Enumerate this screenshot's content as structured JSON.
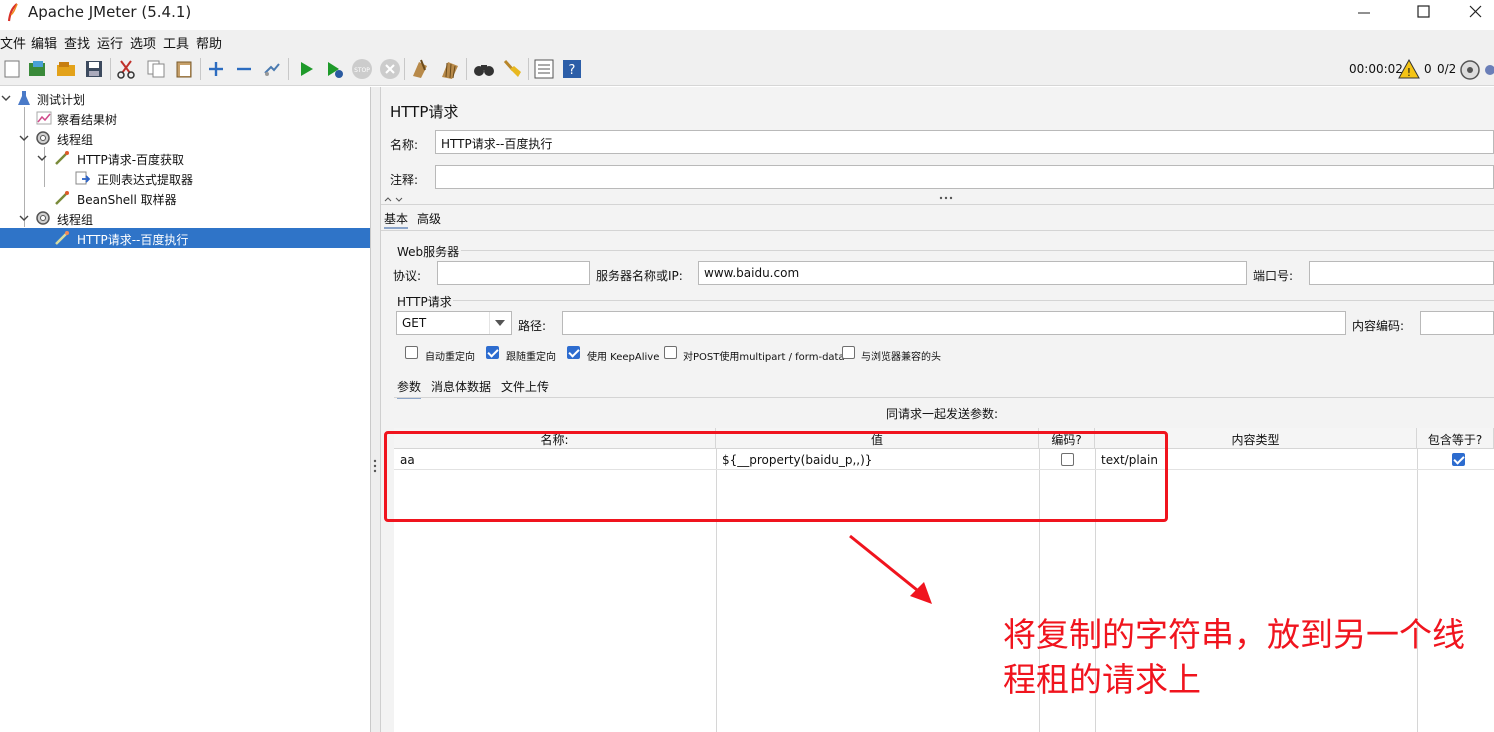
{
  "window": {
    "title": "Apache JMeter (5.4.1)",
    "minimize_icon": "minimize-icon",
    "maximize_icon": "maximize-icon",
    "close_icon": "close-icon"
  },
  "menu": [
    "文件",
    "编辑",
    "查找",
    "运行",
    "选项",
    "工具",
    "帮助"
  ],
  "toolbar": {
    "icons": [
      "new-icon",
      "templates-icon",
      "open-icon",
      "save-icon",
      "cut-icon",
      "copy-icon",
      "paste-icon",
      "expand-icon",
      "collapse-icon",
      "toggle-icon",
      "start-icon",
      "start-no-pause-icon",
      "stop-icon",
      "shutdown-icon",
      "clear-icon",
      "clear-all-icon",
      "search-icon",
      "reset-search-icon",
      "function-helper-icon",
      "help-icon"
    ],
    "elapsed_time": "00:00:02",
    "warning_count": "0",
    "active_threads": "0/2"
  },
  "tree": {
    "items": [
      {
        "label": "测试计划",
        "icon": "test-plan-icon"
      },
      {
        "label": "察看结果树",
        "icon": "result-tree-icon"
      },
      {
        "label": "线程组",
        "icon": "thread-group-icon"
      },
      {
        "label": "HTTP请求-百度获取",
        "icon": "sampler-icon"
      },
      {
        "label": "正则表达式提取器",
        "icon": "extractor-icon"
      },
      {
        "label": "BeanShell 取样器",
        "icon": "sampler-icon"
      },
      {
        "label": "线程组",
        "icon": "thread-group-icon"
      },
      {
        "label": "HTTP请求--百度执行",
        "icon": "sampler-icon",
        "selected": true
      }
    ]
  },
  "panel": {
    "title": "HTTP请求",
    "name_label": "名称:",
    "name_value": "HTTP请求--百度执行",
    "comment_label": "注释:",
    "comment_value": "",
    "tabs": [
      "基本",
      "高级"
    ],
    "web_server": {
      "group_title": "Web服务器",
      "protocol_label": "协议:",
      "protocol_value": "",
      "server_label": "服务器名称或IP:",
      "server_value": "www.baidu.com",
      "port_label": "端口号:",
      "port_value": ""
    },
    "http_request": {
      "group_title": "HTTP请求",
      "method": "GET",
      "path_label": "路径:",
      "path_value": "",
      "encoding_label": "内容编码:",
      "encoding_value": ""
    },
    "checkboxes": [
      {
        "label": "自动重定向",
        "checked": false
      },
      {
        "label": "跟随重定向",
        "checked": true
      },
      {
        "label": "使用 KeepAlive",
        "checked": true
      },
      {
        "label": "对POST使用multipart / form-data",
        "checked": false
      },
      {
        "label": "与浏览器兼容的头",
        "checked": false
      }
    ],
    "sub_tabs": [
      "参数",
      "消息体数据",
      "文件上传"
    ],
    "params_caption": "同请求一起发送参数:",
    "table": {
      "headers": [
        "名称:",
        "值",
        "编码?",
        "内容类型",
        "包含等于?"
      ],
      "rows": [
        {
          "name": "aa",
          "value": "${__property(baidu_p,,)}",
          "encode": false,
          "content_type": "text/plain",
          "include_equals": true
        }
      ]
    }
  },
  "annotation": {
    "line1": "将复制的字符串，放到另一个线",
    "line2": "程租的请求上",
    "color": "#f0141e"
  }
}
